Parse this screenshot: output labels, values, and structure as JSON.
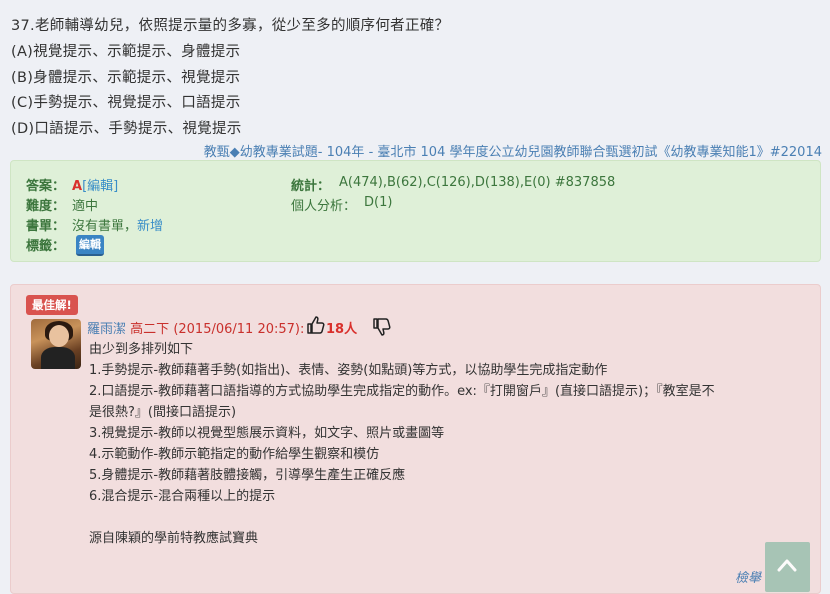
{
  "question": {
    "stem": "37.老師輔導幼兒，依照提示量的多寡，從少至多的順序何者正確？",
    "options": [
      "(A)視覺提示、示範提示、身體提示",
      "(B)身體提示、示範提示、視覺提示",
      "(C)手勢提示、視覺提示、口語提示",
      "(D)口語提示、手勢提示、視覺提示"
    ],
    "source": {
      "category": "教甄◆幼教專業試題",
      "sep1": "- 104年 - ",
      "exam": "臺北市 104 學年度公立幼兒園教師聯合甄選初試《幼教專業知能1》#22014"
    }
  },
  "answer_box": {
    "answer_label": "答案：",
    "answer_value": "A",
    "edit_link": "[編輯]",
    "difficulty_label": "難度：",
    "difficulty_value": "適中",
    "booklist_label": "書單：",
    "booklist_value": "沒有書單，",
    "booklist_add": "新增",
    "tags_label": "標籤：",
    "tags_edit": "編輯",
    "stats_label": "統計：",
    "stats_value": "A(474),B(62),C(126),D(138),E(0) #837858",
    "personal_label": "個人分析：",
    "personal_value": "D(1)"
  },
  "comment": {
    "badge": "最佳解!",
    "author": "羅雨潔",
    "grade": "高二下",
    "timestamp": "(2015/06/11 20:57):",
    "likes": "18人",
    "lines": [
      "由少到多排列如下",
      "1.手勢提示-教師藉著手勢(如指出)、表情、姿勢(如點頭)等方式，以協助學生完成指定動作",
      "2.口語提示-教師藉著口語指導的方式協助學生完成指定的動作。ex:『打開窗戶』(直接口語提示)；『教室是不",
      "是很熱?』(間接口語提示)",
      "3.視覺提示-教師以視覺型態展示資料，如文字、照片或畫圖等",
      "4.示範動作-教師示範指定的動作給學生觀察和模仿",
      "5.身體提示-教師藉著肢體接觸，引導學生產生正確反應",
      "6.混合提示-混合兩種以上的提示",
      "",
      "源自陳穎的學前特教應試寶典"
    ],
    "report": "檢舉"
  },
  "icons": [
    "thumbs-up-icon",
    "thumbs-down-icon",
    "arrow-up-icon"
  ],
  "colors": {
    "link": "#4a7fb3",
    "success_bg": "#dff0d8",
    "danger_bg": "#f2dede",
    "badge_red": "#d9534f"
  }
}
